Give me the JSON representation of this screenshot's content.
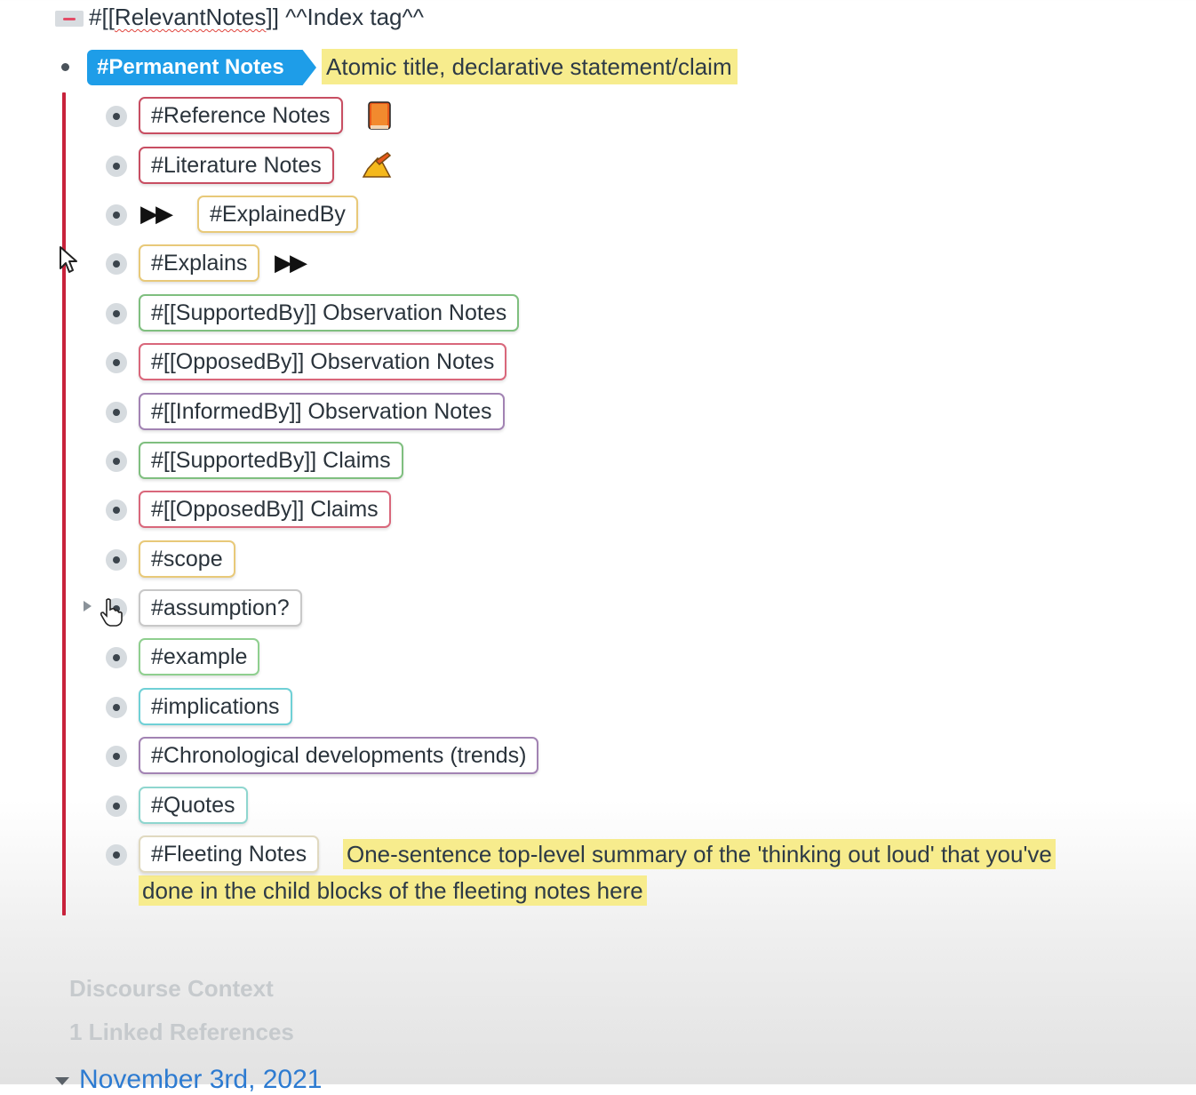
{
  "header": {
    "tag_prefix": "#[[",
    "tag_name": "RelevantNotes",
    "tag_suffix": "]]",
    "trailing": " ^^Index tag^^"
  },
  "main": {
    "tag_label": "#Permanent Notes",
    "description": "Atomic title, declarative statement/claim",
    "accent_color": "#1e9de8",
    "highlight_color": "#f7ec8d"
  },
  "children": [
    {
      "label": "#Reference Notes",
      "icon": "book-icon",
      "border": "#c84e62"
    },
    {
      "label": "#Literature Notes",
      "icon": "writing-hand-icon",
      "border": "#c84e62"
    },
    {
      "label": "#ExplainedBy",
      "icon_before": "double-play-icon",
      "border": "#e8c979"
    },
    {
      "label": "#Explains",
      "icon_after": "double-play-icon",
      "border": "#e8c979"
    },
    {
      "label": "#[[SupportedBy]] Observation Notes",
      "border": "#7fbf7f"
    },
    {
      "label": "#[[OpposedBy]] Observation Notes",
      "border": "#d9677b"
    },
    {
      "label": "#[[InformedBy]] Observation Notes",
      "border": "#a283b3"
    },
    {
      "label": "#[[SupportedBy]] Claims",
      "border": "#7fbf7f"
    },
    {
      "label": "#[[OpposedBy]] Claims",
      "border": "#d9677b"
    },
    {
      "label": "#scope",
      "border": "#e8c979"
    },
    {
      "label": "#assumption?",
      "border": "#c8c8c8"
    },
    {
      "label": "#example",
      "border": "#8fcf8f"
    },
    {
      "label": "#implications",
      "border": "#6fd0d6"
    },
    {
      "label": "#Chronological developments (trends)",
      "border": "#a283b3"
    },
    {
      "label": "#Quotes",
      "border": "#8fd6cf"
    },
    {
      "label": "#Fleeting Notes",
      "border": "#e0d9c0"
    }
  ],
  "fleeting_description": "One-sentence top-level summary of the 'thinking out loud' that you've done in the child blocks of the fleeting notes here",
  "footer": {
    "discourse_context": "Discourse Context",
    "linked_references": "1 Linked References",
    "date": "November 3rd, 2021"
  }
}
